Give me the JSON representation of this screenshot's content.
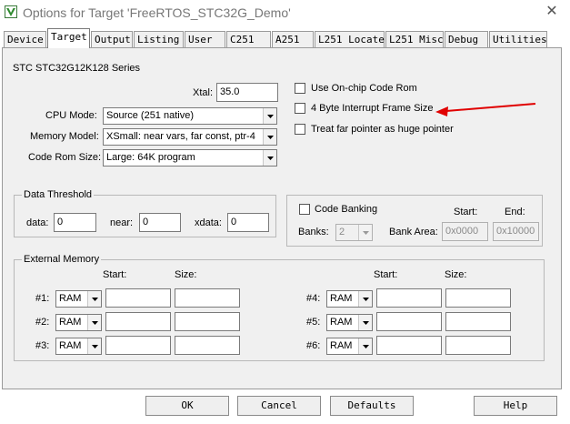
{
  "window": {
    "title": "Options for Target 'FreeRTOS_STC32G_Demo'",
    "close_glyph": "✕"
  },
  "tabs": [
    {
      "label": "Device",
      "active": false
    },
    {
      "label": "Target",
      "active": true
    },
    {
      "label": "Output",
      "active": false
    },
    {
      "label": "Listing",
      "active": false
    },
    {
      "label": "User",
      "active": false
    },
    {
      "label": "C251",
      "active": false
    },
    {
      "label": "A251",
      "active": false
    },
    {
      "label": "L251 Locate",
      "active": false
    },
    {
      "label": "L251 Misc",
      "active": false
    },
    {
      "label": "Debug",
      "active": false
    },
    {
      "label": "Utilities",
      "active": false
    }
  ],
  "target": {
    "series": "STC STC32G12K128 Series",
    "xtal_label": "Xtal:",
    "xtal_value": "35.0",
    "cpu_mode_label": "CPU Mode:",
    "cpu_mode_value": "Source (251 native)",
    "memory_model_label": "Memory Model:",
    "memory_model_value": "XSmall: near vars, far const, ptr-4",
    "code_rom_label": "Code Rom Size:",
    "code_rom_value": "Large: 64K program",
    "options": [
      {
        "label": "Use On-chip Code Rom",
        "checked": false
      },
      {
        "label": "4 Byte Interrupt Frame Size",
        "checked": false
      },
      {
        "label": "Treat far pointer as huge pointer",
        "checked": false
      }
    ]
  },
  "data_threshold": {
    "title": "Data Threshold",
    "data_label": "data:",
    "data_value": "0",
    "near_label": "near:",
    "near_value": "0",
    "xdata_label": "xdata:",
    "xdata_value": "0"
  },
  "code_banking": {
    "label": "Code Banking",
    "checked": false,
    "start_label": "Start:",
    "end_label": "End:",
    "banks_label": "Banks:",
    "banks_value": "2",
    "bank_area_label": "Bank Area:",
    "start_value": "0x0000",
    "end_value": "0x10000"
  },
  "external_memory": {
    "title": "External Memory",
    "start_label": "Start:",
    "size_label": "Size:",
    "rows_left": [
      {
        "label": "#1:",
        "type": "RAM",
        "start": "",
        "size": ""
      },
      {
        "label": "#2:",
        "type": "RAM",
        "start": "",
        "size": ""
      },
      {
        "label": "#3:",
        "type": "RAM",
        "start": "",
        "size": ""
      }
    ],
    "rows_right": [
      {
        "label": "#4:",
        "type": "RAM",
        "start": "",
        "size": ""
      },
      {
        "label": "#5:",
        "type": "RAM",
        "start": "",
        "size": ""
      },
      {
        "label": "#6:",
        "type": "RAM",
        "start": "",
        "size": ""
      }
    ]
  },
  "buttons": {
    "ok": "OK",
    "cancel": "Cancel",
    "defaults": "Defaults",
    "help": "Help"
  },
  "annotation": {
    "arrow_color": "#e00000"
  }
}
